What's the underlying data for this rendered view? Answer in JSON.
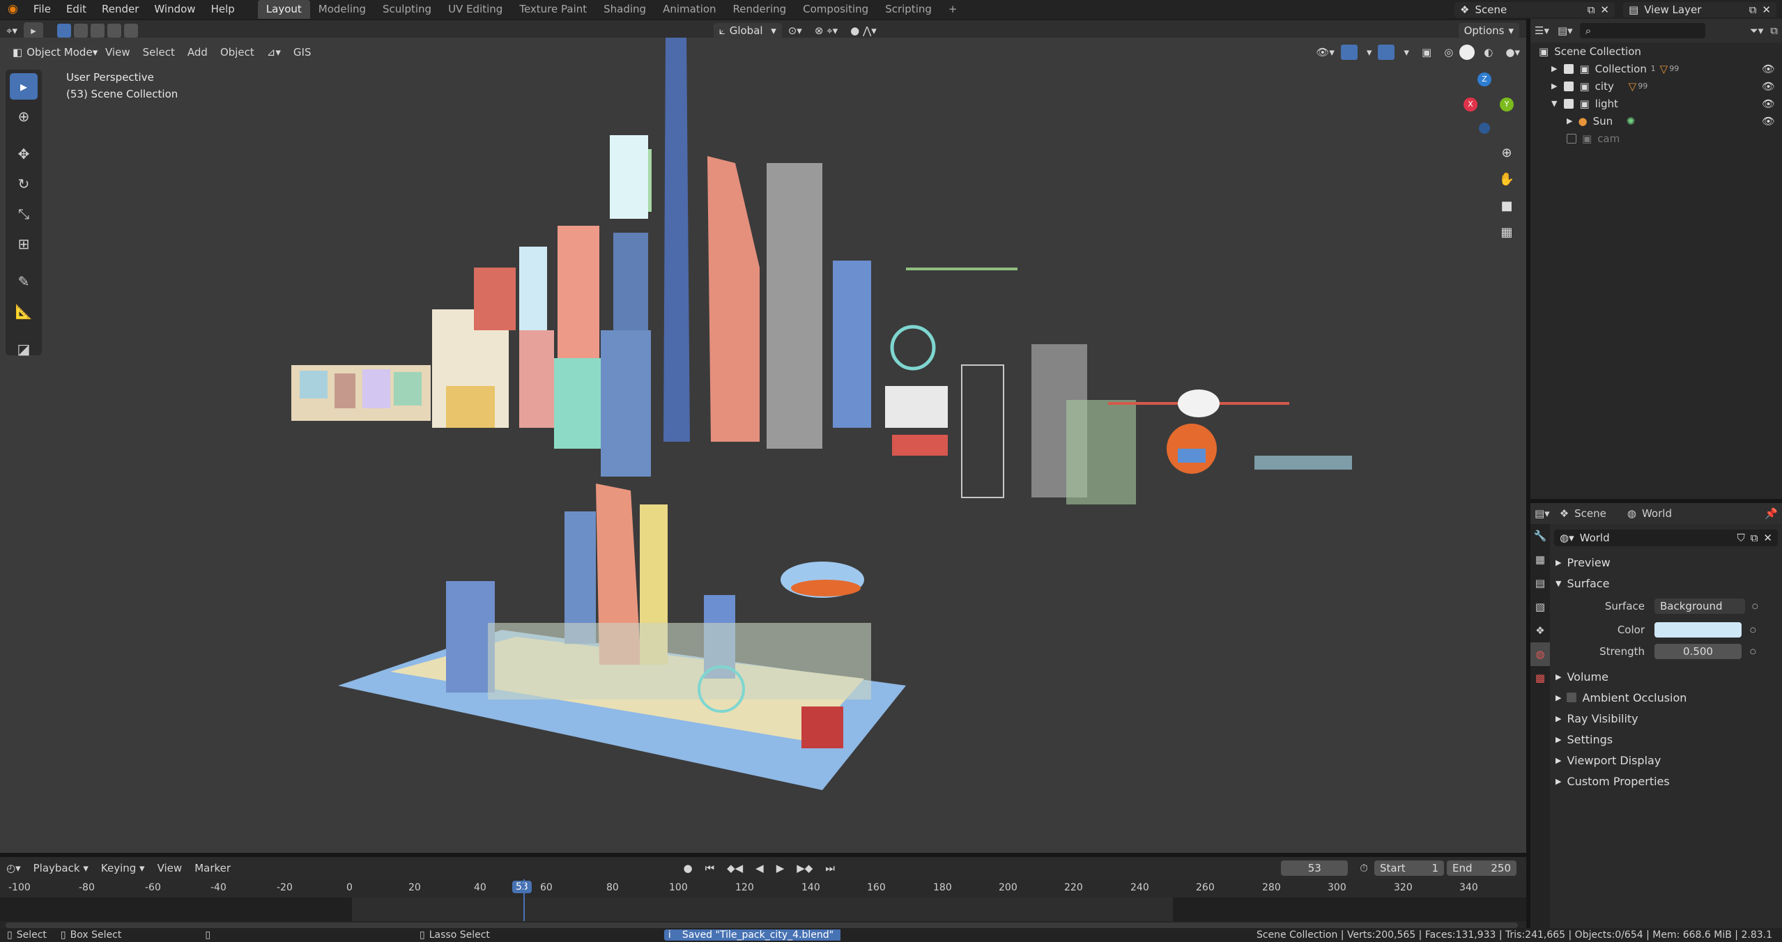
{
  "topbar": {
    "menus": [
      "File",
      "Edit",
      "Render",
      "Window",
      "Help"
    ],
    "workspaces": [
      "Layout",
      "Modeling",
      "Sculpting",
      "UV Editing",
      "Texture Paint",
      "Shading",
      "Animation",
      "Rendering",
      "Compositing",
      "Scripting"
    ],
    "active_workspace": "Layout",
    "add_tab": "+",
    "scene_label": "Scene",
    "view_layer_label": "View Layer"
  },
  "toolbar_row": {
    "transform_orientation": "Global",
    "options": "Options"
  },
  "viewport_header": {
    "mode": "Object Mode",
    "menus": [
      "View",
      "Select",
      "Add",
      "Object",
      "GIS"
    ]
  },
  "viewport": {
    "perspective_label": "User Perspective",
    "collection_label": "(53) Scene Collection",
    "gizmo": {
      "x": "X",
      "y": "Y",
      "z": "Z"
    }
  },
  "outliner": {
    "root": "Scene Collection",
    "items": [
      {
        "label": "Collection",
        "badge": "1",
        "badge2": "99"
      },
      {
        "label": "city",
        "badge": "99"
      },
      {
        "label": "light"
      },
      {
        "label": "Sun"
      },
      {
        "label": "cam"
      }
    ]
  },
  "properties": {
    "scene_tab": "Scene",
    "world_tab": "World",
    "world_name": "World",
    "sections": {
      "preview": "Preview",
      "surface": "Surface",
      "volume": "Volume",
      "ambient_occlusion": "Ambient Occlusion",
      "ray_visibility": "Ray Visibility",
      "settings": "Settings",
      "viewport_display": "Viewport Display",
      "custom_properties": "Custom Properties"
    },
    "surface_label": "Surface",
    "surface_value": "Background",
    "color_label": "Color",
    "color_value": "#cfe8f5",
    "strength_label": "Strength",
    "strength_value": "0.500"
  },
  "timeline": {
    "menus": [
      "Playback",
      "Keying",
      "View",
      "Marker"
    ],
    "current_frame": "53",
    "start_label": "Start",
    "start_value": "1",
    "end_label": "End",
    "end_value": "250",
    "ruler": [
      "-100",
      "-80",
      "-60",
      "-40",
      "-20",
      "0",
      "20",
      "40",
      "53",
      "60",
      "80",
      "100",
      "120",
      "140",
      "160",
      "180",
      "200",
      "220",
      "240",
      "260",
      "280",
      "300",
      "320",
      "340"
    ]
  },
  "statusbar": {
    "select": "Select",
    "box_select": "Box Select",
    "lasso_select": "Lasso Select",
    "saved": "Saved \"Tile_pack_city_4.blend\"",
    "stats": "Scene Collection | Verts:200,565 | Faces:131,933 | Tris:241,665 | Objects:0/654 | Mem: 668.6 MiB | 2.83.1"
  },
  "colors": {
    "accent": "#4772b3",
    "frame_marker": "#4772b3",
    "viewport_bg": "#3b3b3b",
    "axis_x": "#e0334a",
    "axis_y": "#7bbb1d",
    "axis_z": "#2e7dd1"
  }
}
